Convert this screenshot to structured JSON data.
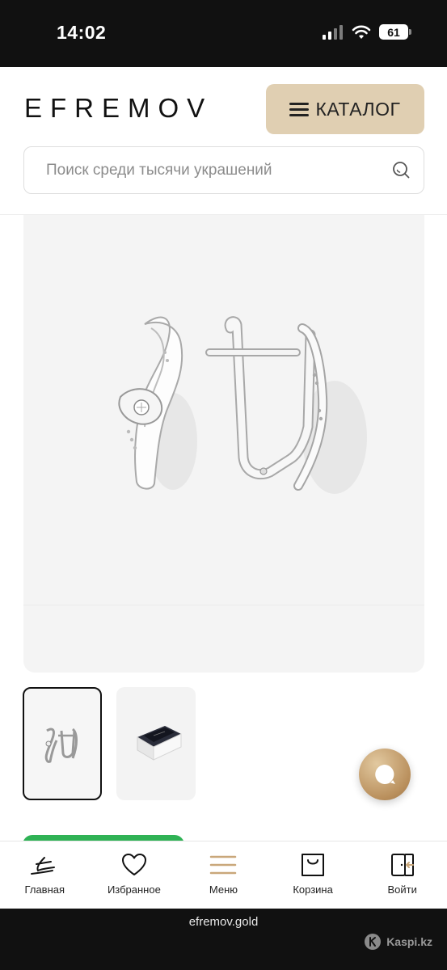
{
  "status_bar": {
    "time": "14:02",
    "battery": "61"
  },
  "header": {
    "logo": "EFREMOV",
    "catalog_label": "КАТАЛОГ",
    "search_placeholder": "Поиск среди тысячи украшений"
  },
  "product": {
    "image_alt": "earrings-photo",
    "thumbnails": [
      "earrings-thumbnail",
      "box-thumbnail"
    ]
  },
  "bottom_nav": {
    "items": [
      {
        "label": "Главная",
        "icon": "home-logo-icon"
      },
      {
        "label": "Избранное",
        "icon": "heart-icon"
      },
      {
        "label": "Меню",
        "icon": "menu-icon"
      },
      {
        "label": "Корзина",
        "icon": "bag-icon"
      },
      {
        "label": "Войти",
        "icon": "login-icon"
      }
    ]
  },
  "browser": {
    "url": "efremov.gold",
    "watermark": "Kaspi.kz"
  },
  "colors": {
    "accent": "#e0cfb2",
    "menu_icon": "#c9a77a",
    "chat": "#b98f5c",
    "cta": "#2fb255"
  }
}
